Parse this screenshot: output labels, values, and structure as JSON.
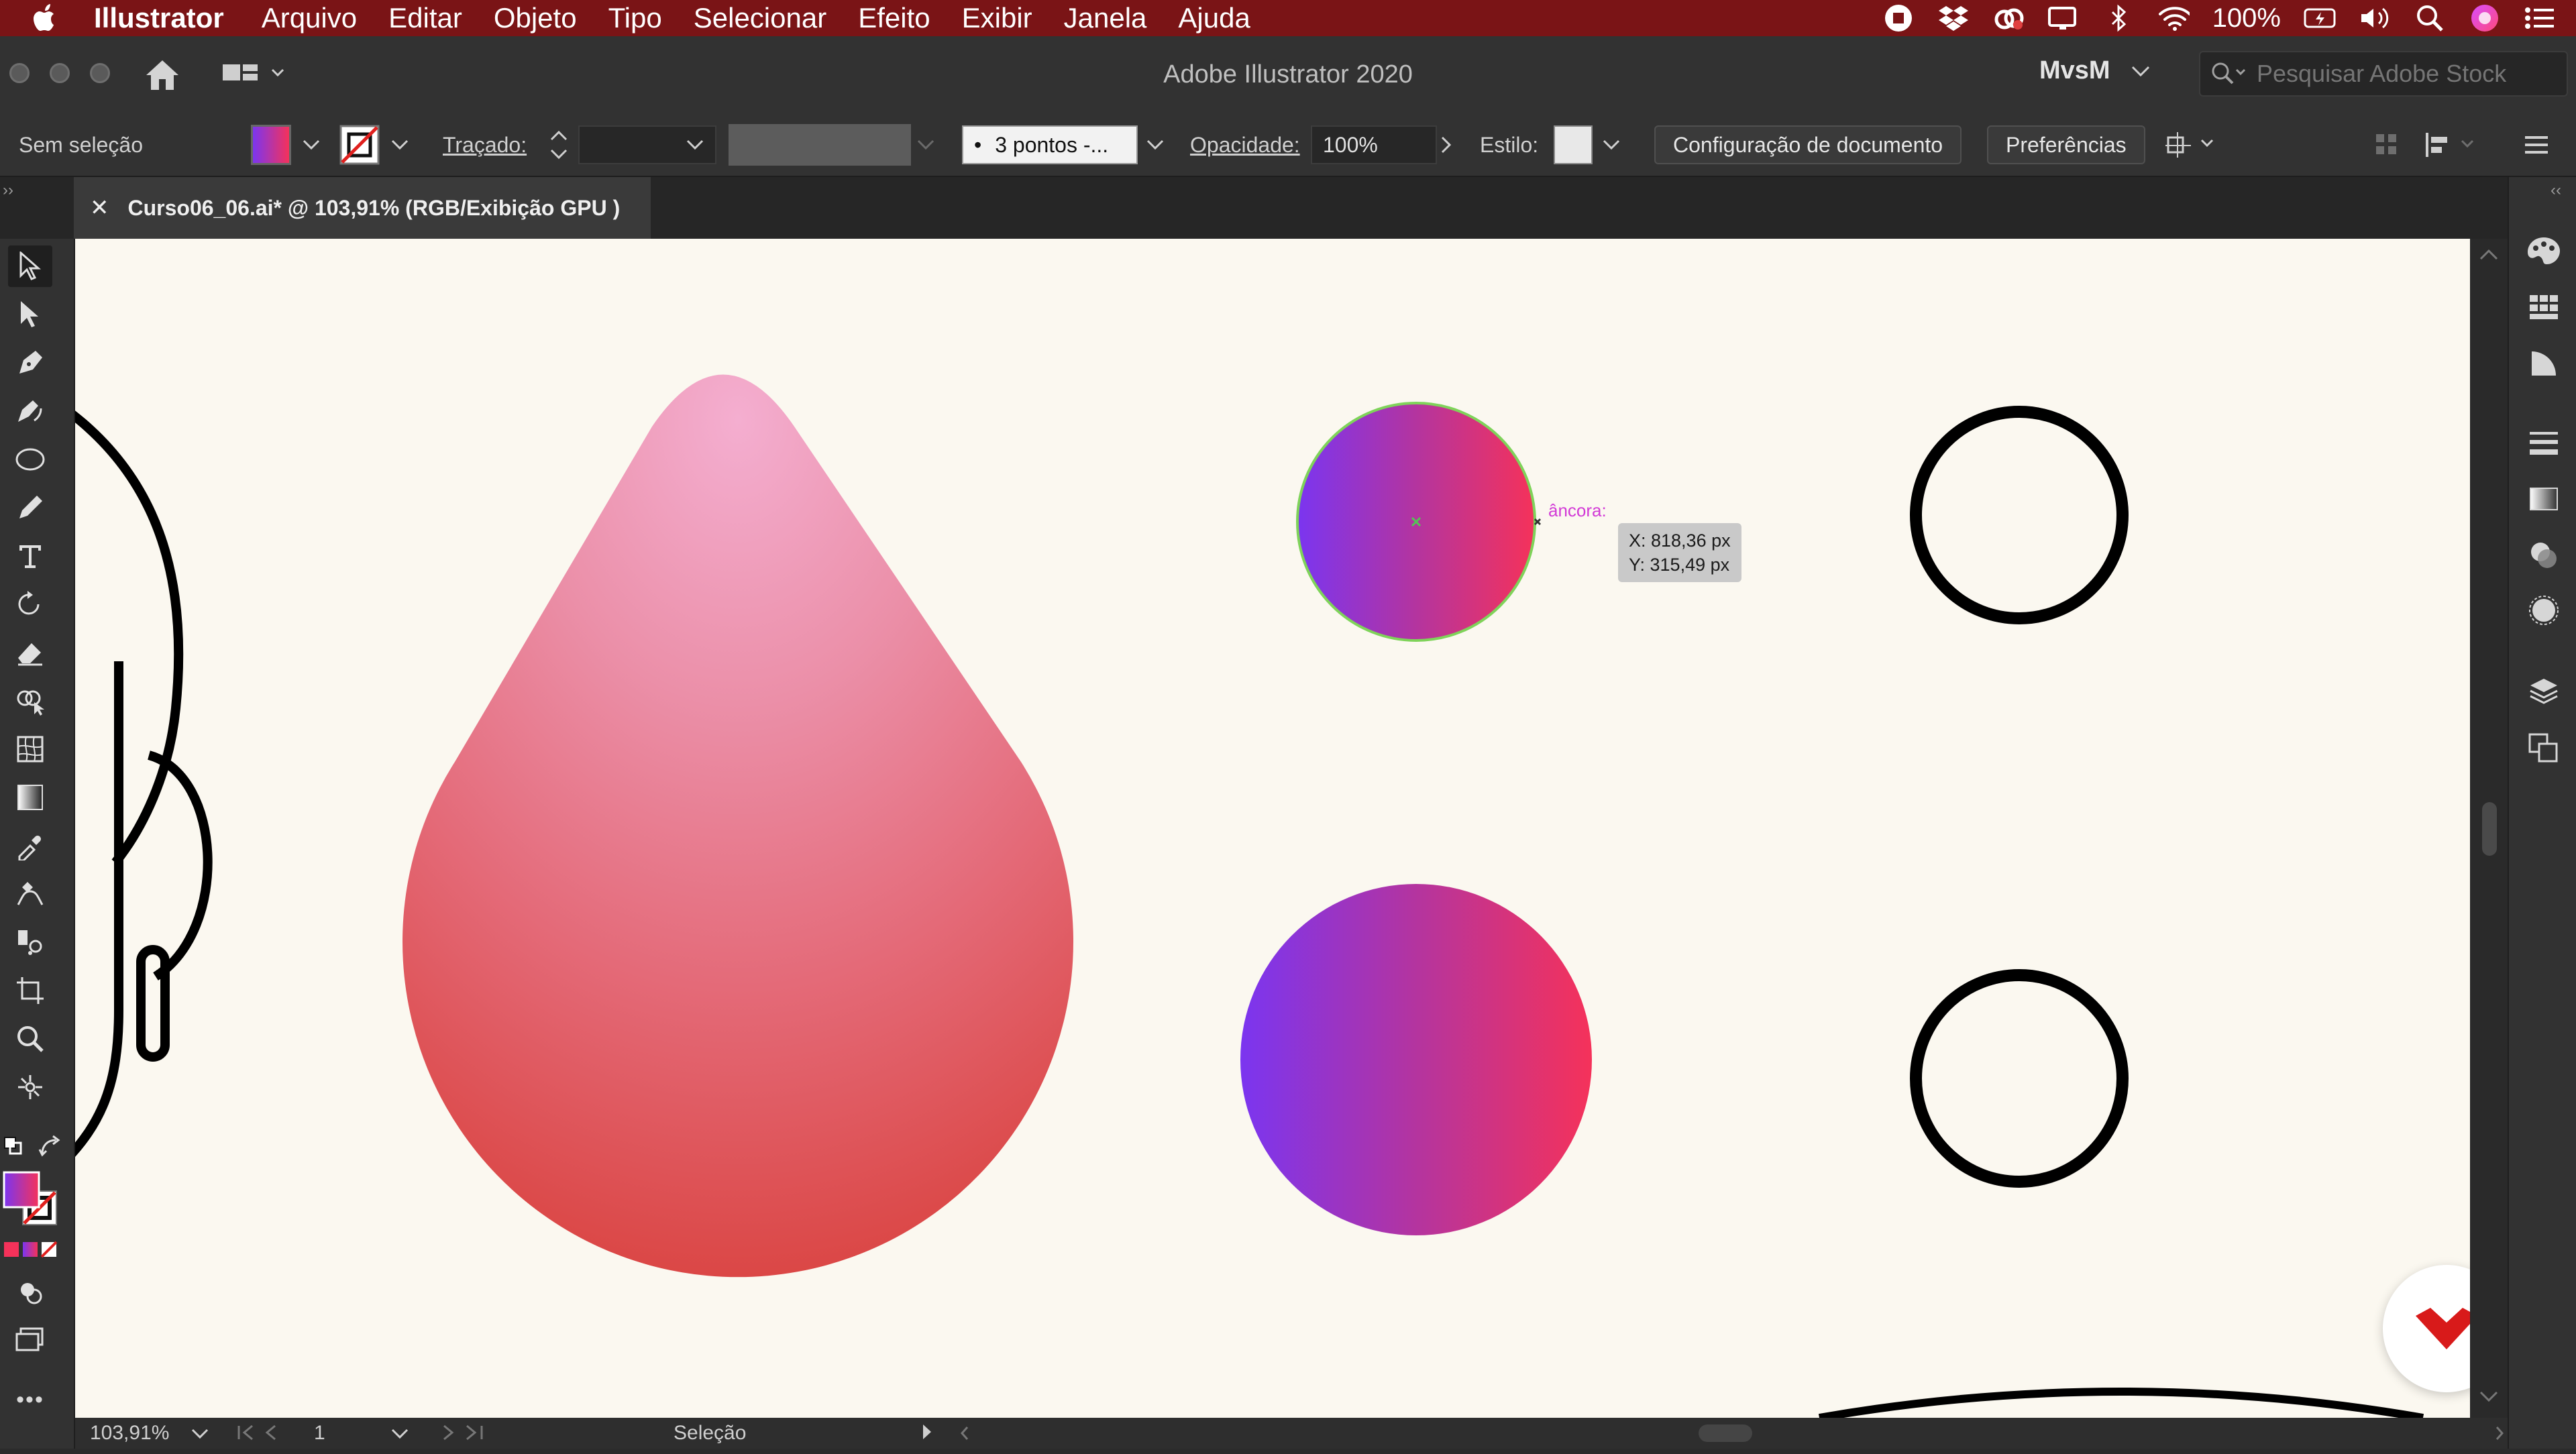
{
  "menubar": {
    "app_name": "Illustrator",
    "items": [
      "Arquivo",
      "Editar",
      "Objeto",
      "Tipo",
      "Selecionar",
      "Efeito",
      "Exibir",
      "Janela",
      "Ajuda"
    ],
    "battery": "100%"
  },
  "titlebar": {
    "title": "Adobe Illustrator 2020",
    "workspace": "MvsM",
    "stock_placeholder": "Pesquisar Adobe Stock"
  },
  "controlbar": {
    "selection_status": "Sem seleção",
    "stroke_label": "Traçado:",
    "brush_value": "3 pontos -...",
    "opacity_label": "Opacidade:",
    "opacity_value": "100%",
    "style_label": "Estilo:",
    "doc_setup_button": "Configuração de documento",
    "preferences_button": "Preferências"
  },
  "document_tab": {
    "label": "Curso06_06.ai* @ 103,91% (RGB/Exibição GPU )"
  },
  "canvas": {
    "anchor_label": "âncora:",
    "coord_x": "X: 818,36 px",
    "coord_y": "Y: 315,49 px"
  },
  "statusbar": {
    "zoom": "103,91%",
    "artboard": "1",
    "tool_name": "Seleção"
  },
  "colors": {
    "menubar_bg": "#7a1416",
    "gradient_start": "#7b35f0",
    "gradient_end": "#f5325a",
    "drop_top": "#f2a9cd",
    "drop_bottom": "#dd4038"
  }
}
